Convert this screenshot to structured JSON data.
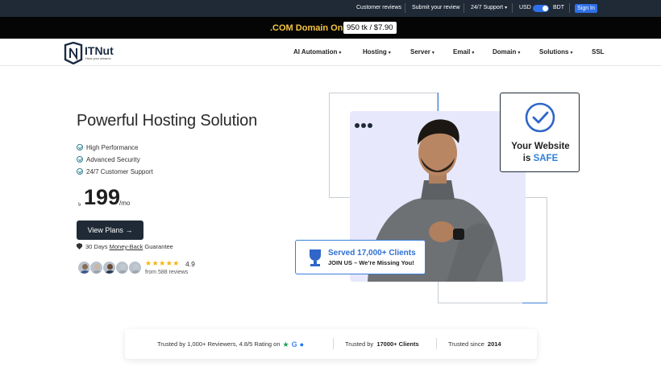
{
  "topbar": {
    "customer_reviews": "Customer reviews",
    "submit_review": "Submit your review",
    "support": "24/7 Support",
    "currency_left": "USD",
    "currency_right": "BDT",
    "sign_in": "Sign In"
  },
  "promo": {
    "text": ".COM Domain Only",
    "price": "950 tk / $7.90"
  },
  "brand": {
    "name": "ITNut",
    "tagline": "Host your dreams"
  },
  "nav": {
    "items": [
      {
        "label": "AI Automation"
      },
      {
        "label": "Hosting"
      },
      {
        "label": "Server"
      },
      {
        "label": "Email"
      },
      {
        "label": "Domain"
      },
      {
        "label": "Solutions"
      },
      {
        "label": "SSL"
      }
    ]
  },
  "hero": {
    "title": "Powerful Hosting Solution",
    "features": [
      "High Performance",
      "Advanced Security",
      "24/7 Customer Support"
    ],
    "currency_symbol": "৳",
    "price": "199",
    "period": "/mo",
    "cta": "View Plans",
    "guarantee_prefix": "30 Days ",
    "guarantee_link": "Money-Back",
    "guarantee_suffix": " Guarantee",
    "stars": "★★★★★",
    "rating": "4.9",
    "reviews": "from 588 reviews"
  },
  "safe_card": {
    "line1": "Your Website",
    "line2_prefix": "is ",
    "line2_accent": "SAFE"
  },
  "served_card": {
    "title": "Served 17,000+ Clients",
    "subtitle": "JOIN US – We’re Missing You!"
  },
  "trust_bar": {
    "reviewers": "Trusted by 1,000+ Reviewers, 4.8/5 Rating on",
    "clients_prefix": "Trusted by",
    "clients_value": "17000+ Clients",
    "since_prefix": "Trusted since",
    "since_value": "2014"
  },
  "colors": {
    "topbar": "#1f2a36",
    "promo_bg": "#050505",
    "promo_text": "#f6c544",
    "accent_blue": "#2f6fe8",
    "panel_bg": "#e7e8fb"
  }
}
